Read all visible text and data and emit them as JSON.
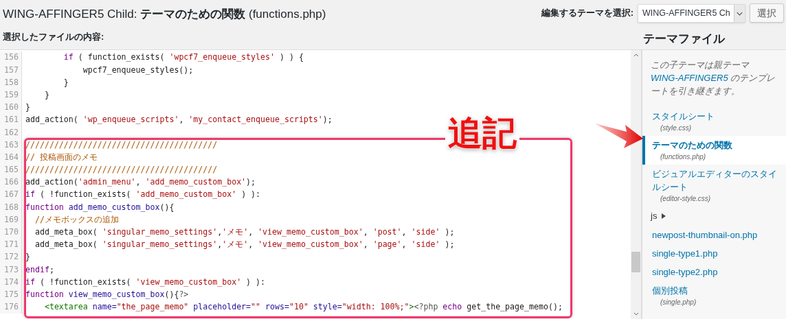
{
  "page_title": "WING-AFFINGER5 Child: **テーマのための関数** (functions.php)",
  "theme_select": {
    "label": "編集するテーマを選択:",
    "value": "WING-AFFINGER5 Ch",
    "button": "選択"
  },
  "content_label": "選択したファイルの内容:",
  "editor": {
    "lines": [
      {
        "number": "156",
        "tokens": [
          {
            "kind": "keyword",
            "text": "        if"
          },
          {
            "kind": "plain",
            "text": " ( function_exists( "
          },
          {
            "kind": "string",
            "text": "'wpcf7_enqueue_styles'"
          },
          {
            "kind": "plain",
            "text": " ) ) {"
          }
        ]
      },
      {
        "number": "157",
        "tokens": [
          {
            "kind": "plain",
            "text": "            wpcf7_enqueue_styles();"
          }
        ]
      },
      {
        "number": "158",
        "tokens": [
          {
            "kind": "plain",
            "text": "        }"
          }
        ]
      },
      {
        "number": "159",
        "tokens": [
          {
            "kind": "plain",
            "text": "    }"
          }
        ]
      },
      {
        "number": "160",
        "tokens": [
          {
            "kind": "plain",
            "text": "}"
          }
        ]
      },
      {
        "number": "161",
        "tokens": [
          {
            "kind": "plain",
            "text": "add_action( "
          },
          {
            "kind": "string",
            "text": "'wp_enqueue_scripts'"
          },
          {
            "kind": "plain",
            "text": ", "
          },
          {
            "kind": "string",
            "text": "'my_contact_enqueue_scripts'"
          },
          {
            "kind": "plain",
            "text": ");"
          }
        ]
      },
      {
        "number": "162"
      },
      {
        "number": "163",
        "tokens": [
          {
            "kind": "comment",
            "text": "////////////////////////////////////////"
          }
        ]
      },
      {
        "number": "164",
        "tokens": [
          {
            "kind": "comment",
            "text": "// 投稿画面のメモ"
          }
        ]
      },
      {
        "number": "165",
        "tokens": [
          {
            "kind": "comment",
            "text": "////////////////////////////////////////"
          }
        ]
      },
      {
        "number": "166",
        "tokens": [
          {
            "kind": "plain",
            "text": "add_action("
          },
          {
            "kind": "string",
            "text": "'admin_menu'"
          },
          {
            "kind": "plain",
            "text": ", "
          },
          {
            "kind": "string",
            "text": "'add_memo_custom_box'"
          },
          {
            "kind": "plain",
            "text": ");"
          }
        ]
      },
      {
        "number": "167",
        "tokens": [
          {
            "kind": "keyword",
            "text": "if"
          },
          {
            "kind": "plain",
            "text": " ( !function_exists( "
          },
          {
            "kind": "string",
            "text": "'add_memo_custom_box'"
          },
          {
            "kind": "plain",
            "text": " ) ):"
          }
        ]
      },
      {
        "number": "168",
        "tokens": [
          {
            "kind": "keyword",
            "text": "function"
          },
          {
            "kind": "def",
            "text": " add_memo_custom_box"
          },
          {
            "kind": "plain",
            "text": "(){"
          }
        ]
      },
      {
        "number": "169",
        "tokens": [
          {
            "kind": "comment",
            "text": "  //メモボックスの追加"
          }
        ]
      },
      {
        "number": "170",
        "tokens": [
          {
            "kind": "plain",
            "text": "  add_meta_box( "
          },
          {
            "kind": "string",
            "text": "'singular_memo_settings'"
          },
          {
            "kind": "plain",
            "text": ","
          },
          {
            "kind": "string",
            "text": "'メモ'"
          },
          {
            "kind": "plain",
            "text": ", "
          },
          {
            "kind": "string",
            "text": "'view_memo_custom_box'"
          },
          {
            "kind": "plain",
            "text": ", "
          },
          {
            "kind": "string",
            "text": "'post'"
          },
          {
            "kind": "plain",
            "text": ", "
          },
          {
            "kind": "string",
            "text": "'side'"
          },
          {
            "kind": "plain",
            "text": " );"
          }
        ]
      },
      {
        "number": "171",
        "tokens": [
          {
            "kind": "plain",
            "text": "  add_meta_box( "
          },
          {
            "kind": "string",
            "text": "'singular_memo_settings'"
          },
          {
            "kind": "plain",
            "text": ","
          },
          {
            "kind": "string",
            "text": "'メモ'"
          },
          {
            "kind": "plain",
            "text": ", "
          },
          {
            "kind": "string",
            "text": "'view_memo_custom_box'"
          },
          {
            "kind": "plain",
            "text": ", "
          },
          {
            "kind": "string",
            "text": "'page'"
          },
          {
            "kind": "plain",
            "text": ", "
          },
          {
            "kind": "string",
            "text": "'side'"
          },
          {
            "kind": "plain",
            "text": " );"
          }
        ]
      },
      {
        "number": "172",
        "tokens": [
          {
            "kind": "plain",
            "text": "}"
          }
        ]
      },
      {
        "number": "173",
        "tokens": [
          {
            "kind": "keyword",
            "text": "endif"
          },
          {
            "kind": "plain",
            "text": ";"
          }
        ]
      },
      {
        "number": "174",
        "tokens": [
          {
            "kind": "keyword",
            "text": "if"
          },
          {
            "kind": "plain",
            "text": " ( !function_exists( "
          },
          {
            "kind": "string",
            "text": "'view_memo_custom_box'"
          },
          {
            "kind": "plain",
            "text": " ) ):"
          }
        ]
      },
      {
        "number": "175",
        "tokens": [
          {
            "kind": "keyword",
            "text": "function"
          },
          {
            "kind": "def",
            "text": " view_memo_custom_box"
          },
          {
            "kind": "plain",
            "text": "(){"
          },
          {
            "kind": "meta",
            "text": "?>"
          }
        ]
      },
      {
        "number": "176",
        "tokens": [
          {
            "kind": "tag",
            "text": "    <textarea"
          },
          {
            "kind": "def",
            "text": " name="
          },
          {
            "kind": "string",
            "text": "\"the_page_memo\""
          },
          {
            "kind": "def",
            "text": " placeholder="
          },
          {
            "kind": "string",
            "text": "\"\""
          },
          {
            "kind": "def",
            "text": " rows="
          },
          {
            "kind": "string",
            "text": "\"10\""
          },
          {
            "kind": "def",
            "text": " style="
          },
          {
            "kind": "string",
            "text": "\"width: 100%;\""
          },
          {
            "kind": "tag",
            "text": ">"
          },
          {
            "kind": "meta",
            "text": "<?php"
          },
          {
            "kind": "keyword",
            "text": " echo"
          },
          {
            "kind": "plain",
            "text": " get_the_page_memo();"
          }
        ]
      }
    ]
  },
  "annotation": {
    "label": "追記"
  },
  "sidebar": {
    "title": "テーマファイル",
    "note": {
      "before": "この子テーマは親テーマ",
      "link": "WING-AFFINGER5",
      "after": " のテンプレートを引き継ぎます。"
    },
    "items": [
      {
        "kind": "file",
        "name": "スタイルシート",
        "file": "(style.css)",
        "selected": false
      },
      {
        "kind": "file",
        "name": "テーマのための関数",
        "file": "(functions.php)",
        "selected": true
      },
      {
        "kind": "file",
        "name": "ビジュアルエディターのスタイルシート",
        "file": "(editor-style.css)",
        "selected": false
      },
      {
        "kind": "folder",
        "name": "js",
        "expanded": false
      },
      {
        "kind": "file",
        "name": "newpost-thumbnail-on.php",
        "selected": false
      },
      {
        "kind": "file",
        "name": "single-type1.php",
        "selected": false
      },
      {
        "kind": "file",
        "name": "single-type2.php",
        "selected": false
      },
      {
        "kind": "file",
        "name": "個別投稿",
        "file": "(single.php)",
        "selected": false
      }
    ]
  }
}
